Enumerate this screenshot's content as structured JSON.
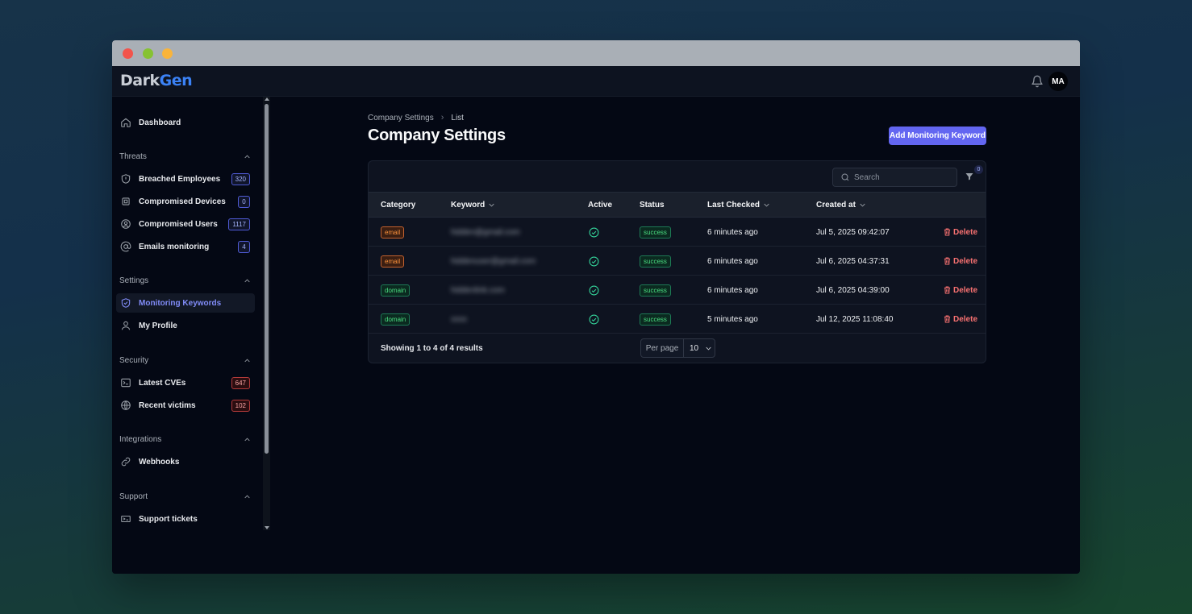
{
  "app": {
    "logo_part1": "Dark",
    "logo_part2": "Gen",
    "avatar_initials": "MA",
    "accent_color": "#6366f1"
  },
  "sidebar": {
    "dashboard": {
      "label": "Dashboard",
      "icon": "home-icon"
    },
    "sections": [
      {
        "title": "Threats",
        "items": [
          {
            "label": "Breached Employees",
            "icon": "shield-alert-icon",
            "badge": "320",
            "badge_color": "blue"
          },
          {
            "label": "Compromised Devices",
            "icon": "cpu-icon",
            "badge": "0",
            "badge_color": "blue"
          },
          {
            "label": "Compromised Users",
            "icon": "user-circle-icon",
            "badge": "1117",
            "badge_color": "blue"
          },
          {
            "label": "Emails monitoring",
            "icon": "at-sign-icon",
            "badge": "4",
            "badge_color": "blue"
          }
        ]
      },
      {
        "title": "Settings",
        "items": [
          {
            "label": "Monitoring Keywords",
            "icon": "shield-check-icon",
            "active": true
          },
          {
            "label": "My Profile",
            "icon": "user-icon"
          }
        ]
      },
      {
        "title": "Security",
        "items": [
          {
            "label": "Latest CVEs",
            "icon": "terminal-icon",
            "badge": "647",
            "badge_color": "red"
          },
          {
            "label": "Recent victims",
            "icon": "globe-icon",
            "badge": "102",
            "badge_color": "red"
          }
        ]
      },
      {
        "title": "Integrations",
        "items": [
          {
            "label": "Webhooks",
            "icon": "link-icon"
          }
        ]
      },
      {
        "title": "Support",
        "items": [
          {
            "label": "Support tickets",
            "icon": "ticket-icon"
          }
        ]
      }
    ]
  },
  "main": {
    "breadcrumb": [
      "Company Settings",
      "List"
    ],
    "title": "Company Settings",
    "add_button": "Add Monitoring Keyword",
    "search_placeholder": "Search",
    "filter_count": "0",
    "columns": [
      "Category",
      "Keyword",
      "Active",
      "Status",
      "Last Checked",
      "Created at"
    ],
    "rows": [
      {
        "category": "email",
        "keyword": "hidden@gmail.com",
        "active": true,
        "status": "success",
        "last_checked": "6 minutes ago",
        "created_at": "Jul 5, 2025 09:42:07",
        "action": "Delete"
      },
      {
        "category": "email",
        "keyword": "hiddenuser@gmail.com",
        "active": true,
        "status": "success",
        "last_checked": "6 minutes ago",
        "created_at": "Jul 6, 2025 04:37:31",
        "action": "Delete"
      },
      {
        "category": "domain",
        "keyword": "hiddenlink.com",
        "active": true,
        "status": "success",
        "last_checked": "6 minutes ago",
        "created_at": "Jul 6, 2025 04:39:00",
        "action": "Delete"
      },
      {
        "category": "domain",
        "keyword": "xxxx",
        "active": true,
        "status": "success",
        "last_checked": "5 minutes ago",
        "created_at": "Jul 12, 2025 11:08:40",
        "action": "Delete"
      }
    ],
    "results_text": "Showing 1 to 4 of 4 results",
    "per_page_label": "Per page",
    "per_page_value": "10"
  }
}
